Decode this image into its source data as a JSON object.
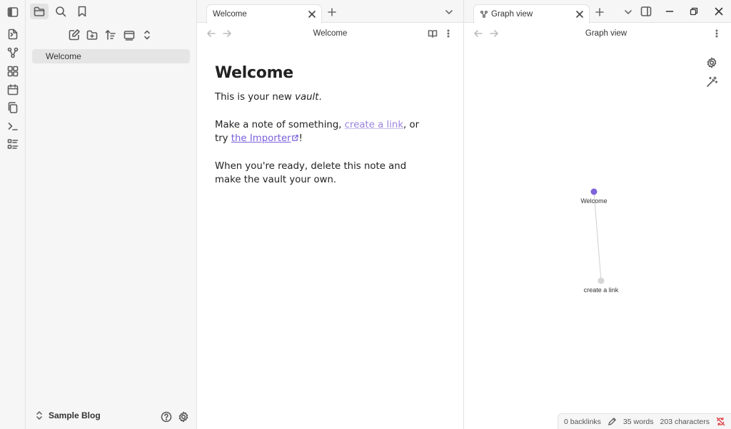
{
  "ribbon": {
    "icons": [
      "open-quick-switcher-icon",
      "graph-view-icon",
      "canvas-icon",
      "daily-note-icon",
      "templates-icon",
      "command-palette-icon",
      "bases-icon"
    ]
  },
  "sidebar": {
    "top_icons": [
      "sidebar-toggle-icon",
      "files-icon",
      "search-icon",
      "bookmark-icon"
    ],
    "nav_icons": [
      "new-note-icon",
      "new-folder-icon",
      "sort-icon",
      "auto-reveal-icon",
      "collapse-all-icon"
    ],
    "files": [
      {
        "label": "Welcome"
      }
    ],
    "vault_name": "Sample Blog"
  },
  "center": {
    "tab_label": "Welcome",
    "view_title": "Welcome",
    "note": {
      "heading": "Welcome",
      "p1_before": "This is your new ",
      "p1_em": "vault",
      "p1_after": ".",
      "p2_before": "Make a note of something, ",
      "p2_link1": "create a link",
      "p2_middle": ", or try ",
      "p2_link2": "the Importer",
      "p2_after": "!",
      "p3": "When you're ready, delete this note and make the vault your own."
    }
  },
  "right": {
    "tab_label": "Graph view",
    "view_title": "Graph view",
    "graph": {
      "nodes": [
        {
          "label": "Welcome",
          "color": "#7f63d9"
        },
        {
          "label": "create a link",
          "color": "#d6d6d6"
        }
      ],
      "edges": [
        [
          0,
          1
        ]
      ]
    }
  },
  "status": {
    "backlinks": "0 backlinks",
    "words": "35 words",
    "characters": "203 characters"
  },
  "colors": {
    "accent": "#7f63d9",
    "link": "#9b82df"
  }
}
